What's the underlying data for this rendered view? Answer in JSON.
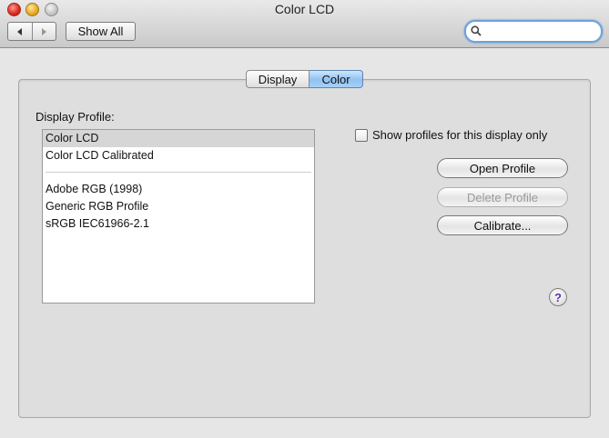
{
  "window": {
    "title": "Color LCD"
  },
  "toolbar": {
    "show_all_label": "Show All",
    "search_value": ""
  },
  "tabs": [
    {
      "label": "Display",
      "selected": false
    },
    {
      "label": "Color",
      "selected": true
    }
  ],
  "profile": {
    "label": "Display Profile:",
    "groups": [
      [
        "Color LCD",
        "Color LCD Calibrated"
      ],
      [
        "Adobe RGB (1998)",
        "Generic RGB Profile",
        "sRGB IEC61966-2.1"
      ]
    ],
    "selected": "Color LCD"
  },
  "options": {
    "show_only_this_display": {
      "label": "Show profiles for this display only",
      "checked": false
    }
  },
  "buttons": {
    "open_profile": "Open Profile",
    "delete_profile": "Delete Profile",
    "calibrate": "Calibrate..."
  },
  "help": {
    "label": "?"
  },
  "colors": {
    "selected_tab": "#8fc2f3",
    "help_glyph": "#5b2fa5",
    "search_focus": "#6da2dc"
  },
  "icons": {
    "back": "chevron-left-icon",
    "forward": "chevron-right-icon",
    "search": "magnifier-icon"
  }
}
